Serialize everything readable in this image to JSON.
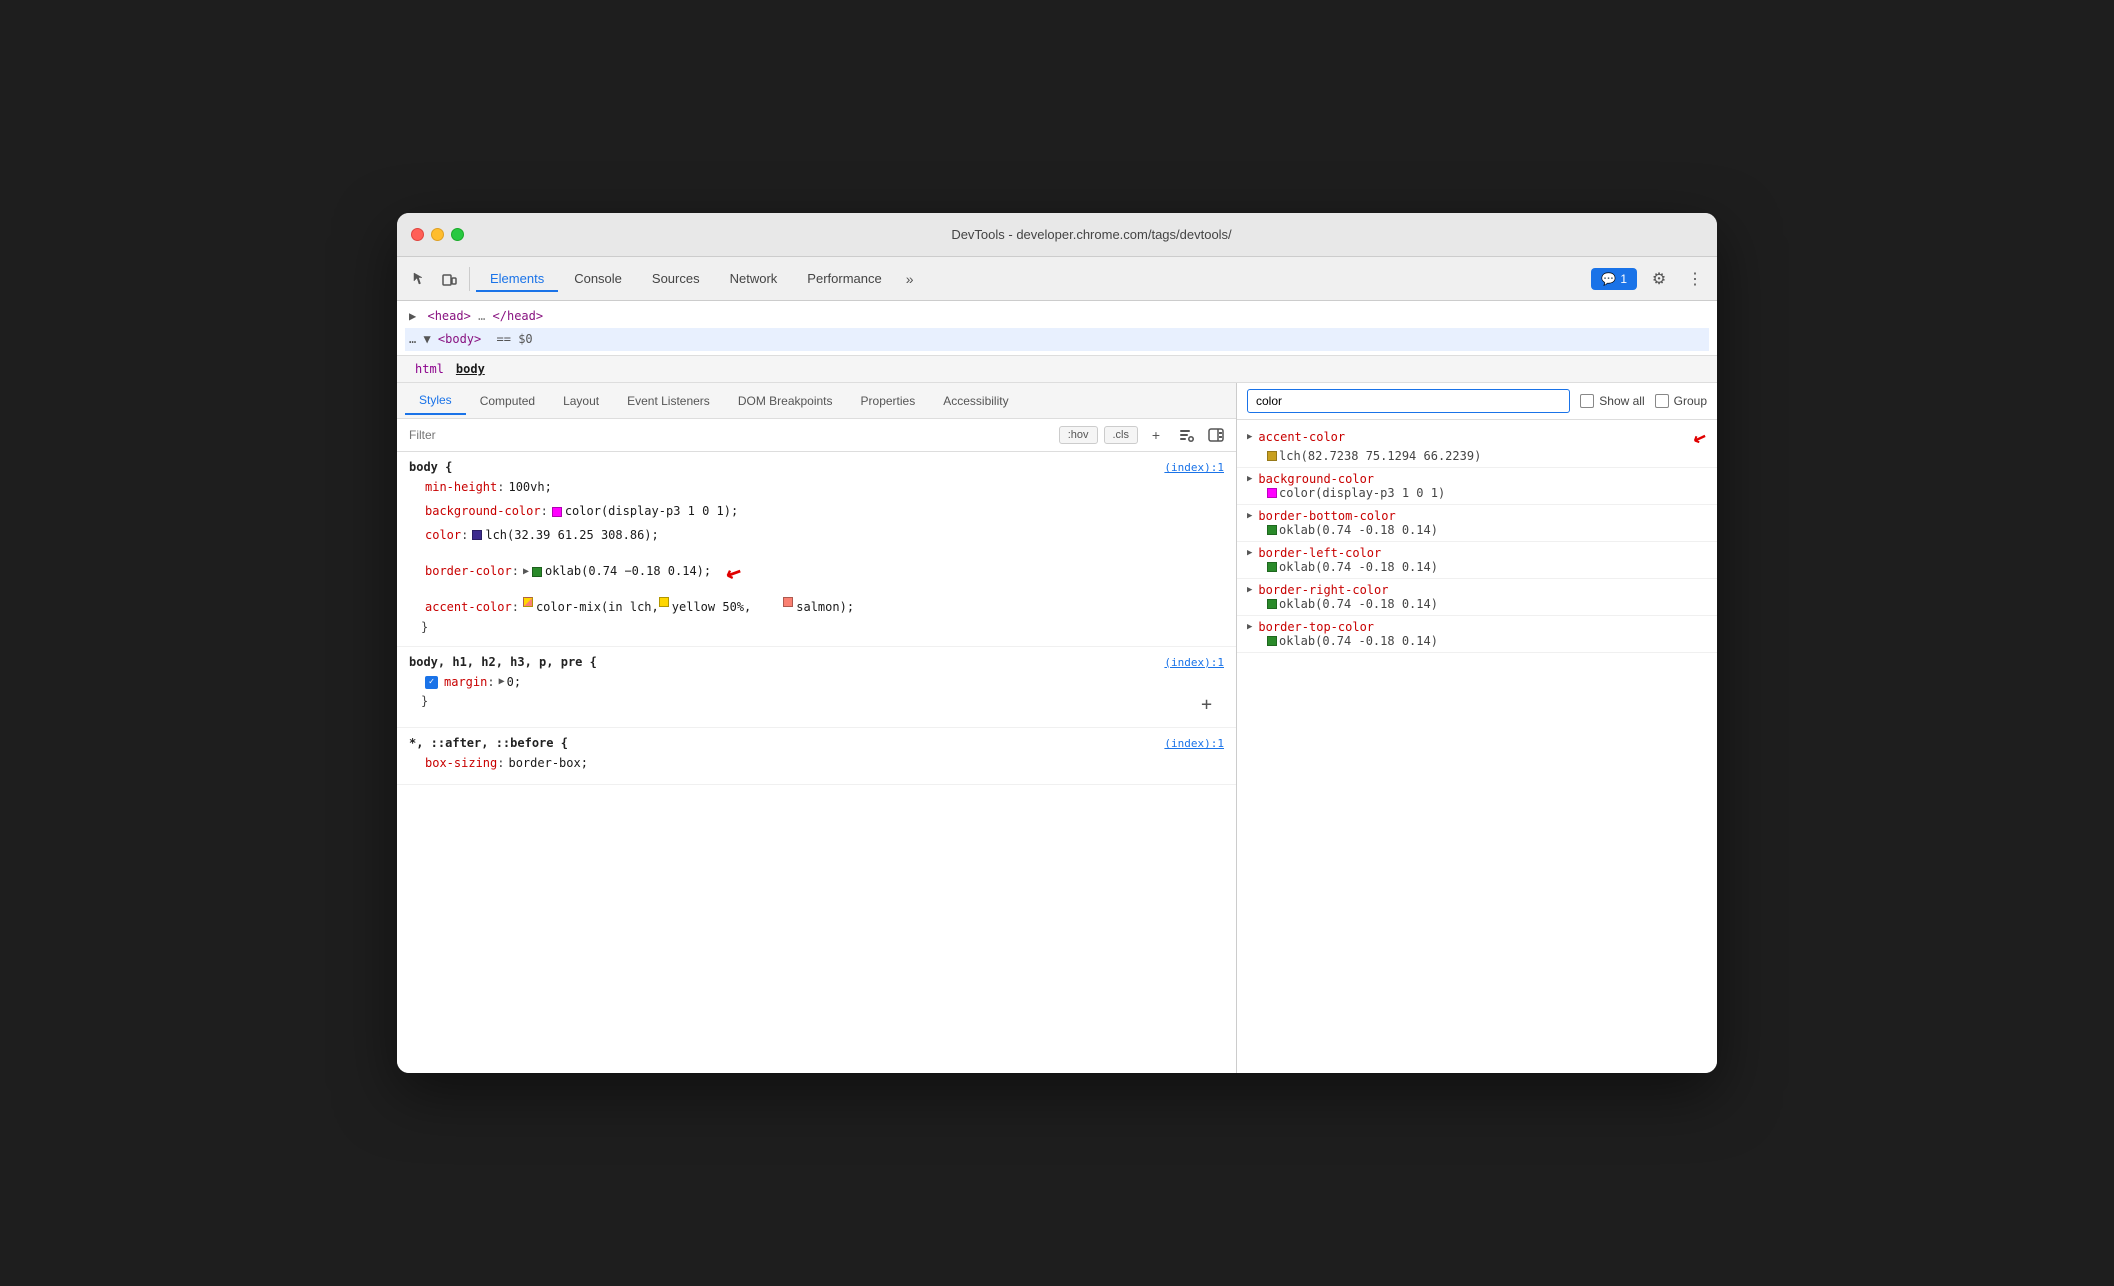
{
  "window": {
    "title": "DevTools - developer.chrome.com/tags/devtools/"
  },
  "toolbar": {
    "tabs": [
      {
        "label": "Elements",
        "active": true
      },
      {
        "label": "Console",
        "active": false
      },
      {
        "label": "Sources",
        "active": false
      },
      {
        "label": "Network",
        "active": false
      },
      {
        "label": "Performance",
        "active": false
      }
    ],
    "more_label": "»",
    "badge_label": "💬 1",
    "gear_icon": "⚙",
    "more_icon": "⋮"
  },
  "dom": {
    "head_line": "<head> … </head>",
    "body_line": "… ▼ <body> == $0"
  },
  "breadcrumb": {
    "items": [
      "html",
      "body"
    ]
  },
  "sub_tabs": {
    "tabs": [
      {
        "label": "Styles",
        "active": true
      },
      {
        "label": "Computed",
        "active": false
      },
      {
        "label": "Layout",
        "active": false
      },
      {
        "label": "Event Listeners",
        "active": false
      },
      {
        "label": "DOM Breakpoints",
        "active": false
      },
      {
        "label": "Properties",
        "active": false
      },
      {
        "label": "Accessibility",
        "active": false
      }
    ]
  },
  "filter": {
    "placeholder": "Filter",
    "hov_label": ":hov",
    "cls_label": ".cls"
  },
  "css_rules": [
    {
      "selector": "body {",
      "source": "(index):1",
      "props": [
        {
          "prop": "min-height",
          "value": "100vh;",
          "swatch": null,
          "checkbox": false,
          "expand": false
        },
        {
          "prop": "background-color",
          "value": "color(display-p3 1 0 1);",
          "swatch": "#ff00ff",
          "checkbox": false,
          "expand": false
        },
        {
          "prop": "color",
          "value": "lch(32.39 61.25 308.86);",
          "swatch": "#3d2b8e",
          "checkbox": false,
          "expand": false
        },
        {
          "prop": "border-color",
          "value": "oklab(0.74 −0.18 0.14);",
          "swatch": "#2a8a2a",
          "checkbox": false,
          "expand": true
        },
        {
          "prop": "accent-color",
          "value": "color-mix(in lch, ",
          "swatch_gradient": true,
          "value2": "yellow 50%,",
          "value3": "salmon);",
          "checkbox": false,
          "expand": false
        }
      ],
      "close": "}"
    },
    {
      "selector": "body, h1, h2, h3, p, pre {",
      "source": "(index):1",
      "props": [
        {
          "prop": "margin",
          "value": "▶ 0;",
          "checkbox": true,
          "expand": false
        }
      ],
      "close": "}"
    },
    {
      "selector": "*, ::after, ::before {",
      "source": "(index):1",
      "props": [
        {
          "prop": "box-sizing",
          "value": "border-box;",
          "checkbox": false,
          "expand": false
        }
      ],
      "close": ""
    }
  ],
  "computed": {
    "filter_placeholder": "color",
    "show_all_label": "Show all",
    "group_label": "Group",
    "items": [
      {
        "prop": "accent-color",
        "value": "lch(82.7238 75.1294 66.2239)",
        "swatch": "#c8a020",
        "has_arrow": true,
        "annotation": "red-arrow-right"
      },
      {
        "prop": "background-color",
        "value": "color(display-p3 1 0 1)",
        "swatch": "#ff00ff",
        "has_arrow": true
      },
      {
        "prop": "border-bottom-color",
        "value": "oklab(0.74 -0.18 0.14)",
        "swatch": "#2a8a2a",
        "has_arrow": true
      },
      {
        "prop": "border-left-color",
        "value": "oklab(0.74 -0.18 0.14)",
        "swatch": "#2a8a2a",
        "has_arrow": true
      },
      {
        "prop": "border-right-color",
        "value": "oklab(0.74 -0.18 0.14)",
        "swatch": "#2a8a2a",
        "has_arrow": true
      },
      {
        "prop": "border-top-color",
        "value": "oklab(0.74 -0.18 0.14)",
        "swatch": "#2a8a2a",
        "has_arrow": true
      }
    ]
  }
}
